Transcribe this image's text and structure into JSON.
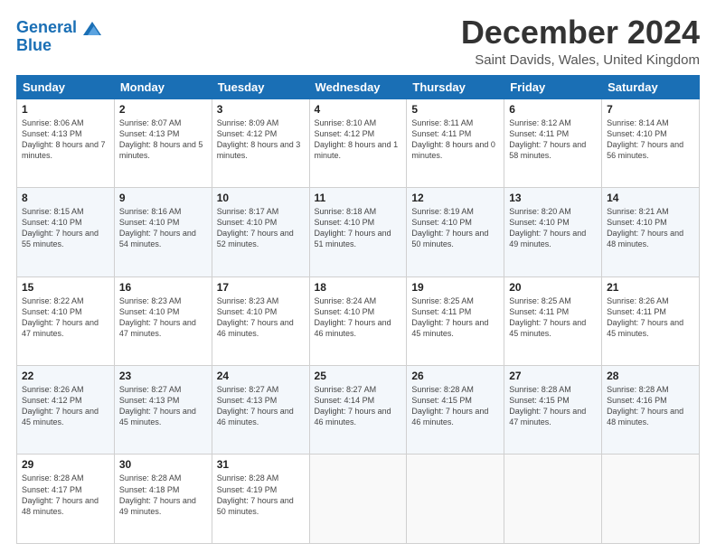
{
  "header": {
    "logo_line1": "General",
    "logo_line2": "Blue",
    "title": "December 2024",
    "location": "Saint Davids, Wales, United Kingdom"
  },
  "weekdays": [
    "Sunday",
    "Monday",
    "Tuesday",
    "Wednesday",
    "Thursday",
    "Friday",
    "Saturday"
  ],
  "weeks": [
    [
      {
        "day": "1",
        "sunrise": "Sunrise: 8:06 AM",
        "sunset": "Sunset: 4:13 PM",
        "daylight": "Daylight: 8 hours and 7 minutes."
      },
      {
        "day": "2",
        "sunrise": "Sunrise: 8:07 AM",
        "sunset": "Sunset: 4:13 PM",
        "daylight": "Daylight: 8 hours and 5 minutes."
      },
      {
        "day": "3",
        "sunrise": "Sunrise: 8:09 AM",
        "sunset": "Sunset: 4:12 PM",
        "daylight": "Daylight: 8 hours and 3 minutes."
      },
      {
        "day": "4",
        "sunrise": "Sunrise: 8:10 AM",
        "sunset": "Sunset: 4:12 PM",
        "daylight": "Daylight: 8 hours and 1 minute."
      },
      {
        "day": "5",
        "sunrise": "Sunrise: 8:11 AM",
        "sunset": "Sunset: 4:11 PM",
        "daylight": "Daylight: 8 hours and 0 minutes."
      },
      {
        "day": "6",
        "sunrise": "Sunrise: 8:12 AM",
        "sunset": "Sunset: 4:11 PM",
        "daylight": "Daylight: 7 hours and 58 minutes."
      },
      {
        "day": "7",
        "sunrise": "Sunrise: 8:14 AM",
        "sunset": "Sunset: 4:10 PM",
        "daylight": "Daylight: 7 hours and 56 minutes."
      }
    ],
    [
      {
        "day": "8",
        "sunrise": "Sunrise: 8:15 AM",
        "sunset": "Sunset: 4:10 PM",
        "daylight": "Daylight: 7 hours and 55 minutes."
      },
      {
        "day": "9",
        "sunrise": "Sunrise: 8:16 AM",
        "sunset": "Sunset: 4:10 PM",
        "daylight": "Daylight: 7 hours and 54 minutes."
      },
      {
        "day": "10",
        "sunrise": "Sunrise: 8:17 AM",
        "sunset": "Sunset: 4:10 PM",
        "daylight": "Daylight: 7 hours and 52 minutes."
      },
      {
        "day": "11",
        "sunrise": "Sunrise: 8:18 AM",
        "sunset": "Sunset: 4:10 PM",
        "daylight": "Daylight: 7 hours and 51 minutes."
      },
      {
        "day": "12",
        "sunrise": "Sunrise: 8:19 AM",
        "sunset": "Sunset: 4:10 PM",
        "daylight": "Daylight: 7 hours and 50 minutes."
      },
      {
        "day": "13",
        "sunrise": "Sunrise: 8:20 AM",
        "sunset": "Sunset: 4:10 PM",
        "daylight": "Daylight: 7 hours and 49 minutes."
      },
      {
        "day": "14",
        "sunrise": "Sunrise: 8:21 AM",
        "sunset": "Sunset: 4:10 PM",
        "daylight": "Daylight: 7 hours and 48 minutes."
      }
    ],
    [
      {
        "day": "15",
        "sunrise": "Sunrise: 8:22 AM",
        "sunset": "Sunset: 4:10 PM",
        "daylight": "Daylight: 7 hours and 47 minutes."
      },
      {
        "day": "16",
        "sunrise": "Sunrise: 8:23 AM",
        "sunset": "Sunset: 4:10 PM",
        "daylight": "Daylight: 7 hours and 47 minutes."
      },
      {
        "day": "17",
        "sunrise": "Sunrise: 8:23 AM",
        "sunset": "Sunset: 4:10 PM",
        "daylight": "Daylight: 7 hours and 46 minutes."
      },
      {
        "day": "18",
        "sunrise": "Sunrise: 8:24 AM",
        "sunset": "Sunset: 4:10 PM",
        "daylight": "Daylight: 7 hours and 46 minutes."
      },
      {
        "day": "19",
        "sunrise": "Sunrise: 8:25 AM",
        "sunset": "Sunset: 4:11 PM",
        "daylight": "Daylight: 7 hours and 45 minutes."
      },
      {
        "day": "20",
        "sunrise": "Sunrise: 8:25 AM",
        "sunset": "Sunset: 4:11 PM",
        "daylight": "Daylight: 7 hours and 45 minutes."
      },
      {
        "day": "21",
        "sunrise": "Sunrise: 8:26 AM",
        "sunset": "Sunset: 4:11 PM",
        "daylight": "Daylight: 7 hours and 45 minutes."
      }
    ],
    [
      {
        "day": "22",
        "sunrise": "Sunrise: 8:26 AM",
        "sunset": "Sunset: 4:12 PM",
        "daylight": "Daylight: 7 hours and 45 minutes."
      },
      {
        "day": "23",
        "sunrise": "Sunrise: 8:27 AM",
        "sunset": "Sunset: 4:13 PM",
        "daylight": "Daylight: 7 hours and 45 minutes."
      },
      {
        "day": "24",
        "sunrise": "Sunrise: 8:27 AM",
        "sunset": "Sunset: 4:13 PM",
        "daylight": "Daylight: 7 hours and 46 minutes."
      },
      {
        "day": "25",
        "sunrise": "Sunrise: 8:27 AM",
        "sunset": "Sunset: 4:14 PM",
        "daylight": "Daylight: 7 hours and 46 minutes."
      },
      {
        "day": "26",
        "sunrise": "Sunrise: 8:28 AM",
        "sunset": "Sunset: 4:15 PM",
        "daylight": "Daylight: 7 hours and 46 minutes."
      },
      {
        "day": "27",
        "sunrise": "Sunrise: 8:28 AM",
        "sunset": "Sunset: 4:15 PM",
        "daylight": "Daylight: 7 hours and 47 minutes."
      },
      {
        "day": "28",
        "sunrise": "Sunrise: 8:28 AM",
        "sunset": "Sunset: 4:16 PM",
        "daylight": "Daylight: 7 hours and 48 minutes."
      }
    ],
    [
      {
        "day": "29",
        "sunrise": "Sunrise: 8:28 AM",
        "sunset": "Sunset: 4:17 PM",
        "daylight": "Daylight: 7 hours and 48 minutes."
      },
      {
        "day": "30",
        "sunrise": "Sunrise: 8:28 AM",
        "sunset": "Sunset: 4:18 PM",
        "daylight": "Daylight: 7 hours and 49 minutes."
      },
      {
        "day": "31",
        "sunrise": "Sunrise: 8:28 AM",
        "sunset": "Sunset: 4:19 PM",
        "daylight": "Daylight: 7 hours and 50 minutes."
      },
      null,
      null,
      null,
      null
    ]
  ]
}
